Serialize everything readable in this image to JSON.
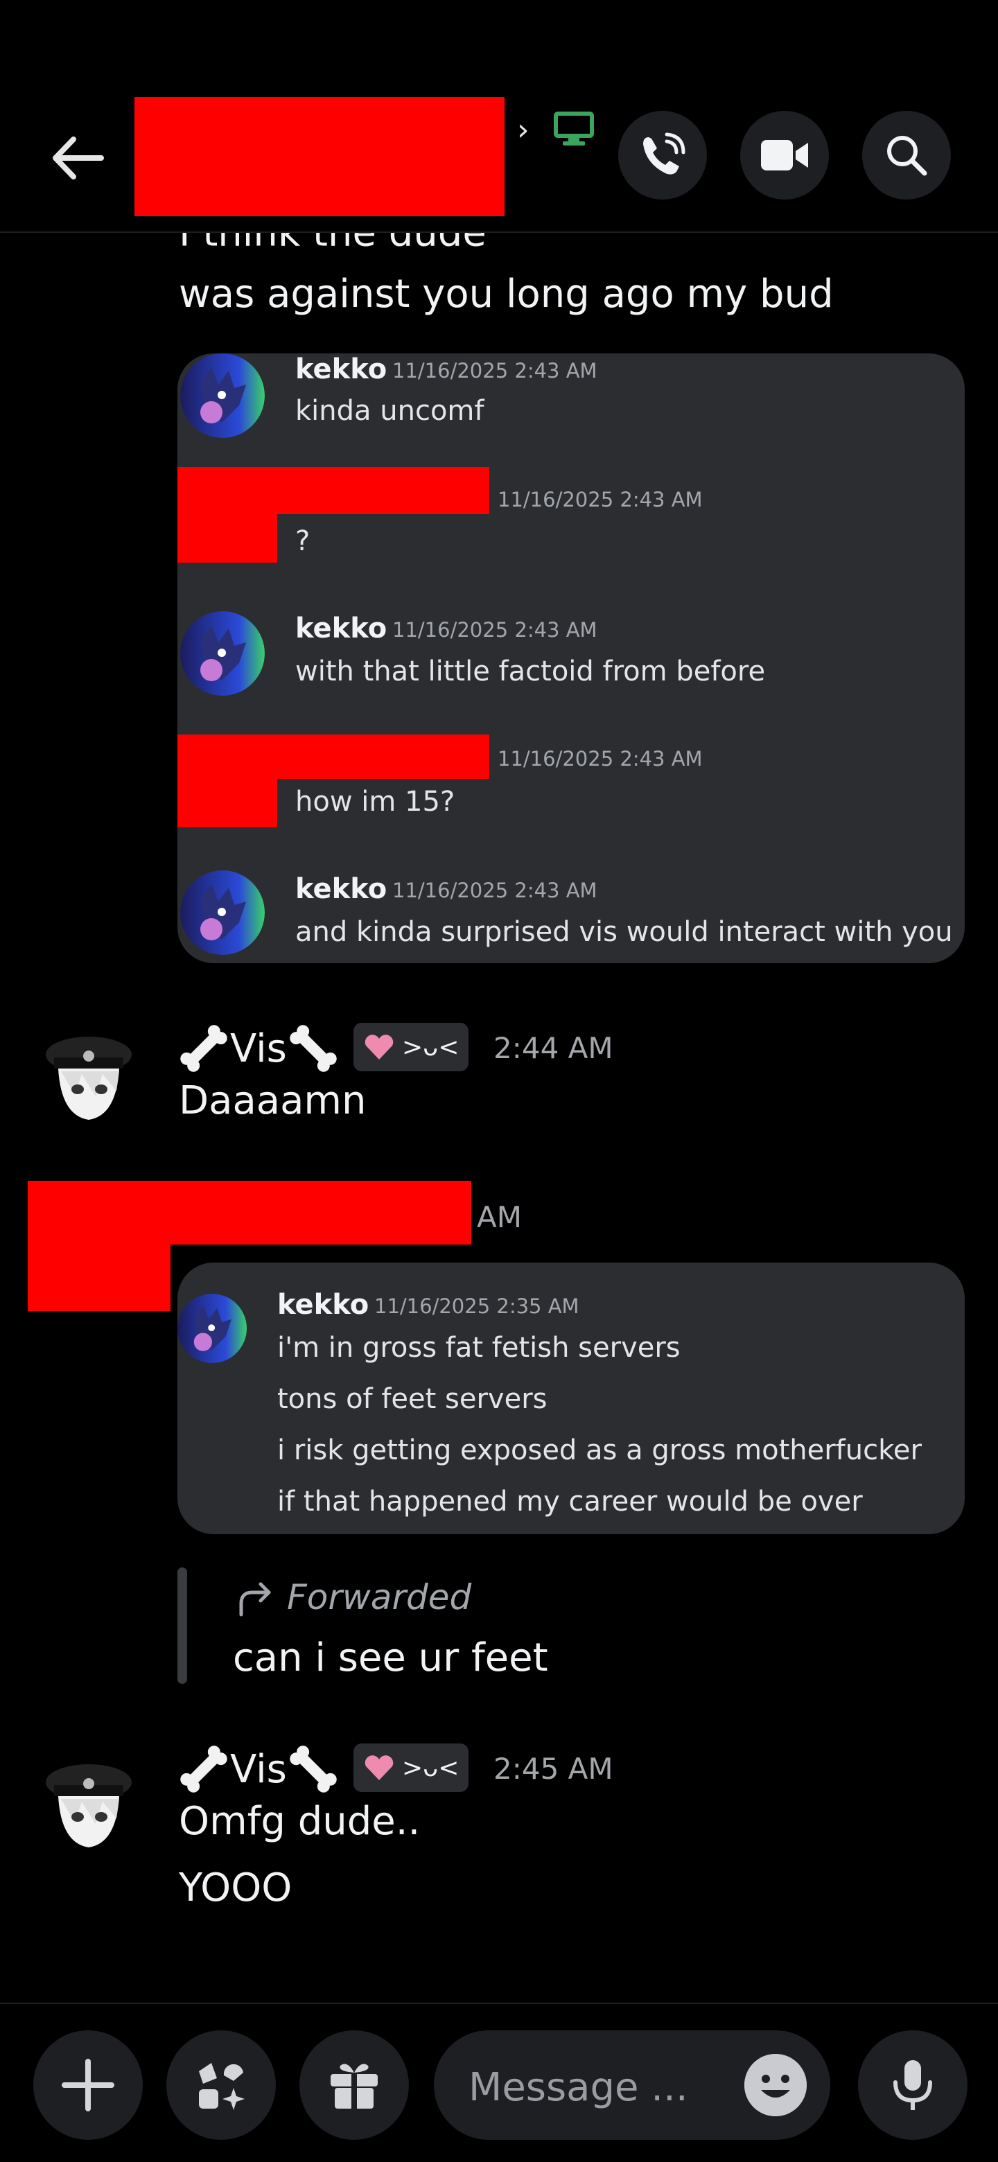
{
  "header": {
    "back_icon": "arrow-left-icon",
    "channel_chevron": "›",
    "call_icon": "phone-call-icon",
    "video_icon": "video-camera-icon",
    "search_icon": "search-icon",
    "status_icon": "desktop-online-icon",
    "status_color": "#3ba55d"
  },
  "messages": {
    "cut_off_line": "I think the dude",
    "line_against": "was against you long ago my bud",
    "quoted_card_1": [
      {
        "author": "kekko",
        "time": "11/16/2025 2:43 AM",
        "text": "kinda uncomf"
      },
      {
        "author": "",
        "time": "11/16/2025 2:43 AM",
        "text": "?"
      },
      {
        "author": "kekko",
        "time": "11/16/2025 2:43 AM",
        "text": "with that little factoid from before"
      },
      {
        "author": "",
        "time": "11/16/2025 2:43 AM",
        "text": "how im 15?"
      },
      {
        "author": "kekko",
        "time": "11/16/2025 2:43 AM",
        "text": "and kinda surprised vis would interact with you"
      }
    ],
    "vis_1": {
      "name": "Vis",
      "tag_emote": ">ᴗ<",
      "time": "2:44 AM",
      "text": "Daaaamn"
    },
    "redacted_time_suffix": "AM",
    "quoted_card_2": {
      "author": "kekko",
      "time": "11/16/2025 2:35 AM",
      "lines": [
        "i'm in gross fat fetish servers",
        "tons of feet servers",
        "i risk getting exposed as a gross motherfucker",
        "if that happened my career would be over"
      ]
    },
    "forwarded": {
      "label": "Forwarded",
      "text": "can i see ur feet"
    },
    "vis_2": {
      "name": "Vis",
      "tag_emote": ">ᴗ<",
      "time": "2:45 AM",
      "lines": [
        "Omfg dude..",
        "YOOO"
      ]
    }
  },
  "composer": {
    "placeholder": "Message ...",
    "add_icon": "plus-icon",
    "apps_icon": "apps-icon",
    "gift_icon": "gift-icon",
    "emoji_icon": "emoji-icon",
    "mic_icon": "microphone-icon"
  },
  "colors": {
    "background": "#000000",
    "card": "#2b2d31",
    "redaction": "#ff0000",
    "muted": "#a3a6aa",
    "tag_heart": "#f08bb0"
  }
}
